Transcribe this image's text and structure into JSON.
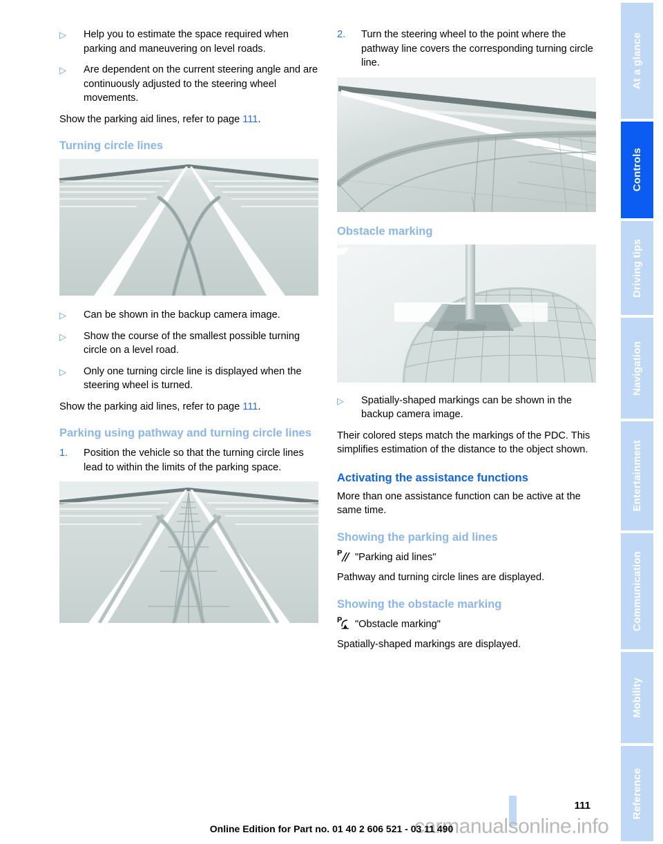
{
  "document": {
    "page_number": "111",
    "edition_note": "Online Edition for Part no. 01 40 2 606 521 - 03 11 490",
    "watermark": "carmanualsonline.info"
  },
  "colors": {
    "link_blue": "#1f6fe8",
    "subheading_blue": "#8ab6ef",
    "heading_blue": "#0f63f0",
    "tab_inactive": "#bfd8f5",
    "tab_active": "#0b5cf2",
    "figure_bg": "#eef1f1"
  },
  "left_column": {
    "bullets_top": [
      {
        "marker": "▷",
        "text": "Help you to estimate the space required when parking and maneuvering on level roads."
      },
      {
        "marker": "▷",
        "text": "Are dependent on the current steering angle and are continuously adjusted to the steering wheel movements."
      }
    ],
    "refer_line_1": {
      "prefix": "Show the parking aid lines, refer to page ",
      "page": "111",
      "suffix": "."
    },
    "heading_turning_circle": "Turning circle lines",
    "figure_turning_circle": "backup-camera-turning-circle-lines",
    "bullets_middle": [
      {
        "marker": "▷",
        "text": "Can be shown in the backup camera image."
      },
      {
        "marker": "▷",
        "text": "Show the course of the smallest possible turning circle on a level road."
      },
      {
        "marker": "▷",
        "text": "Only one turning circle line is displayed when the steering wheel is turned."
      }
    ],
    "refer_line_2": {
      "prefix": "Show the parking aid lines, refer to page ",
      "page": "111",
      "suffix": "."
    },
    "heading_parking_using": "Parking using pathway and turning circle lines",
    "step_1": {
      "index": "1.",
      "text": "Position the vehicle so that the turning circle lines lead to within the limits of the parking space."
    },
    "figure_parking_step1": "backup-camera-parking-space-lines"
  },
  "right_column": {
    "step_2": {
      "index": "2.",
      "text": "Turn the steering wheel to the point where the pathway line covers the corresponding turning circle line."
    },
    "figure_step2": "backup-camera-pathway-over-turning-circle",
    "heading_obstacle": "Obstacle marking",
    "figure_obstacle": "backup-camera-obstacle-marking-pole",
    "bullet_obstacle": {
      "marker": "▷",
      "text": "Spatially-shaped markings can be shown in the backup camera image."
    },
    "paragraph_obstacle": "Their colored steps match the markings of the PDC. This simplifies estimation of the distance to the object shown.",
    "heading_activating": "Activating the assistance functions",
    "paragraph_activating": "More than one assistance function can be active at the same time.",
    "heading_showing_aid_lines": "Showing the parking aid lines",
    "menu_parking_aid_lines": {
      "icon": "parking-aid-lines-icon",
      "label": "\"Parking aid lines\""
    },
    "paragraph_aid_lines": "Pathway and turning circle lines are displayed.",
    "heading_showing_obstacle": "Showing the obstacle marking",
    "menu_obstacle_marking": {
      "icon": "obstacle-marking-icon",
      "label": "\"Obstacle marking\""
    },
    "paragraph_obstacle_displayed": "Spatially-shaped markings are displayed."
  },
  "rail": {
    "tabs": [
      {
        "label": "At a glance",
        "active": false
      },
      {
        "label": "Controls",
        "active": true
      },
      {
        "label": "Driving tips",
        "active": false
      },
      {
        "label": "Navigation",
        "active": false
      },
      {
        "label": "Entertainment",
        "active": false
      },
      {
        "label": "Communication",
        "active": false
      },
      {
        "label": "Mobility",
        "active": false
      },
      {
        "label": "Reference",
        "active": false
      }
    ]
  }
}
